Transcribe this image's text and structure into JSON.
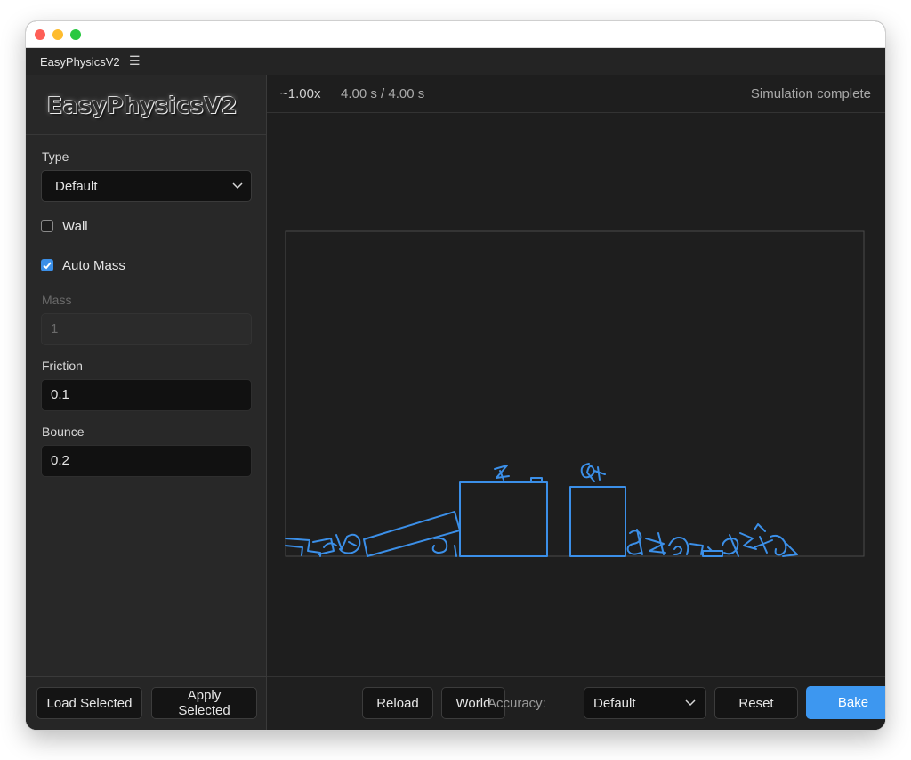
{
  "app": {
    "title": "EasyPhysicsV2",
    "logo_text": "EasyPhysicsV2"
  },
  "sidebar": {
    "type_label": "Type",
    "type_value": "Default",
    "wall_label": "Wall",
    "wall_checked": false,
    "auto_mass_label": "Auto Mass",
    "auto_mass_checked": true,
    "mass_label": "Mass",
    "mass_value": "1",
    "friction_label": "Friction",
    "friction_value": "0.1",
    "bounce_label": "Bounce",
    "bounce_value": "0.2",
    "load_selected": "Load Selected",
    "apply_selected": "Apply Selected"
  },
  "viewport": {
    "speed": "~1.00x",
    "time": "4.00 s / 4.00 s",
    "status": "Simulation complete",
    "outline_color": "#3b8fe8"
  },
  "toolbar": {
    "reload": "Reload",
    "world": "World",
    "accuracy_label": "Accuracy:",
    "accuracy_value": "Default",
    "reset": "Reset",
    "bake": "Bake"
  },
  "colors": {
    "accent": "#3d97f0",
    "background": "#1e1e1e",
    "panel": "#282828"
  }
}
